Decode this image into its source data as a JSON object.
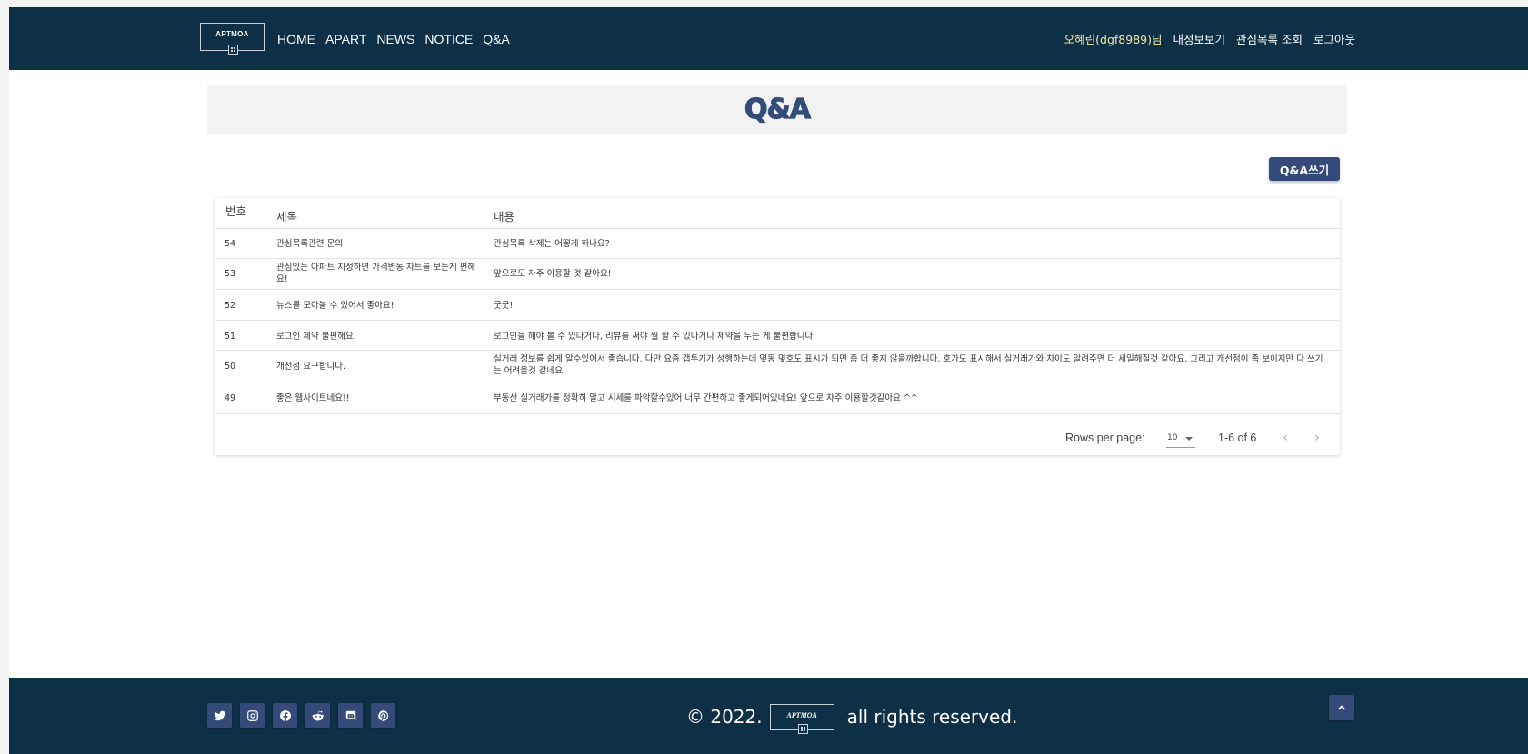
{
  "header": {
    "logo_text": "APTMOA",
    "nav": [
      "HOME",
      "APART",
      "NEWS",
      "NOTICE",
      "Q&A"
    ],
    "username": "오혜린(dgf8989)님",
    "user_links": [
      "내정보보기",
      "관심목록 조회",
      "로그아웃"
    ]
  },
  "page": {
    "title": "Q&A",
    "write_button": "Q&A쓰기"
  },
  "table": {
    "columns": [
      "번호",
      "제목",
      "내용"
    ],
    "rows": [
      {
        "no": "54",
        "title": "관심목록관련 문의",
        "content": "관심목록 삭제는 어떻게 하나요?"
      },
      {
        "no": "53",
        "title": "관심있는 아파트 지정하면 가격변동 차트를 보는게 편해요!",
        "content": "앞으로도 자주 이용할 것 같아요!"
      },
      {
        "no": "52",
        "title": "뉴스를 모아볼 수 있어서 좋아요!",
        "content": "굿굿!"
      },
      {
        "no": "51",
        "title": "로그인 제약 불편해요.",
        "content": "로그인을 해야 볼 수 있다거나, 리뷰를 써야 뭘 할 수 있다거나 제약을 두는 게 불편합니다."
      },
      {
        "no": "50",
        "title": "개선점 요구합니다.",
        "content": "실거래 정보를 쉽게 알수있어서 좋습니다. 다만 요즘 갭투기가 성행하는데 몇동 몇호도 표시가 되면 좀 더 좋지 않을까합니다. 호가도 표시해서 실거래가와 차이도 알려주면 더 세일해질것 같아요. 그리고 개선점이 좀 보이지만 다 쓰기는 어려울것 같네요."
      },
      {
        "no": "49",
        "title": "좋은 웹사이트네요!!",
        "content": "부동산 실거래가를 정확히 알고 시세를 파악할수있어 너무 간편하고 좋게되어있네요! 앞으로 자주 이용할것같아요 ^^"
      }
    ],
    "pagination": {
      "rows_per_page_label": "Rows per page:",
      "rows_per_page_value": "10",
      "range": "1-6 of 6",
      "prev": "‹",
      "next": "›"
    }
  },
  "footer": {
    "copyright_prefix": "© 2022.",
    "copyright_suffix": "all rights reserved.",
    "logo_text": "APTMOA",
    "social_icons": [
      "twitter-icon",
      "instagram-icon",
      "facebook-icon",
      "reddit-icon",
      "discord-icon",
      "pinterest-icon"
    ]
  },
  "colors": {
    "header_bg": "#0e3046",
    "accent": "#344b7a",
    "username": "#f3e7a6"
  }
}
